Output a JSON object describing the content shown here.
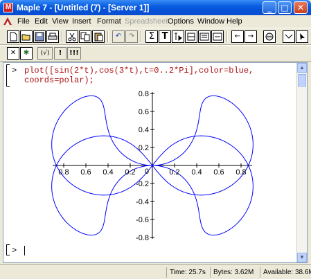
{
  "window": {
    "title": "Maple 7 - [Untitled (7) - [Server 1]]",
    "app_icon_letter": "M",
    "minimize": "_",
    "maximize": "□",
    "close": "✕"
  },
  "menubar": {
    "items": [
      "File",
      "Edit",
      "View",
      "Insert",
      "Format",
      "Spreadsheet",
      "Options",
      "Window",
      "Help"
    ],
    "disabled": [
      "Spreadsheet"
    ]
  },
  "toolbar1": {
    "icons": [
      "new-icon",
      "open-icon",
      "save-icon",
      "print-icon",
      "cut-icon",
      "copy-icon",
      "paste-icon",
      "undo-icon",
      "redo-icon",
      "sigma-icon",
      "text-icon",
      "execute-icon",
      "back-icon",
      "forward-icon",
      "stop-icon",
      "restart-icon"
    ],
    "glyphs": {
      "sigma": "Σ",
      "text": "T",
      "undo": "↶",
      "redo": "↷",
      "back": "←",
      "forward": "→"
    }
  },
  "toolbar2": {
    "glyphs": {
      "x": "✕",
      "star": "✱",
      "v": "(√)",
      "bang": "!",
      "bangs": "!!!"
    }
  },
  "worksheet": {
    "input_prompt": ">",
    "input_line1": "plot([sin(2*t),cos(3*t),t=0..2*Pi],color=blue,",
    "input_line2": "coords=polar);",
    "next_prompt": ">"
  },
  "chart_data": {
    "type": "line",
    "coords": "polar",
    "series": [
      {
        "r_expr": "sin(2*t)",
        "theta_expr": "cos(3*t)",
        "t_range": [
          0,
          6.2832
        ],
        "color": "#0000ff"
      }
    ],
    "xlim": [
      -0.9,
      0.9
    ],
    "ylim": [
      -0.8,
      0.8
    ],
    "x_tick_labels": [
      "0.8",
      "0.6",
      "0.4",
      "0.2",
      "0.2",
      "0.4",
      "0.6",
      "0.8"
    ],
    "y_tick_labels": [
      "0.8",
      "0.6",
      "0.4",
      "0.2",
      "-0.2",
      "-0.4",
      "-0.6",
      "-0.8"
    ],
    "x_ticks": [
      -0.8,
      -0.6,
      -0.4,
      -0.2,
      0.2,
      0.4,
      0.6,
      0.8
    ],
    "y_ticks": [
      0.8,
      0.6,
      0.4,
      0.2,
      -0.2,
      -0.4,
      -0.6,
      -0.8
    ],
    "origin_label": "0"
  },
  "statusbar": {
    "time": "Time: 25.7s",
    "bytes": "Bytes: 3.62M",
    "available": "Available: 38.6M"
  }
}
